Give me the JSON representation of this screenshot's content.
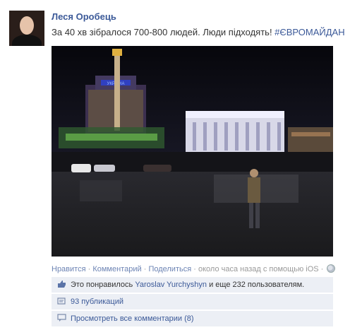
{
  "post": {
    "author": "Леся Оробець",
    "message_text": "За 40 хв зібралося 700-800 людей. Люди підходять! ",
    "hashtag": "#ЄВРОМАЙДАН"
  },
  "photo": {
    "hotel_sign": "УКРАЇНА"
  },
  "actions": {
    "like": "Нравится",
    "comment": "Комментарий",
    "share": "Поделиться",
    "time": "около часа назад с помощью iOS"
  },
  "likes": {
    "prefix": "Это понравилось ",
    "name": "Yaroslav Yurchyshyn",
    "suffix": " и еще 232 пользователям."
  },
  "shares": {
    "label": "93 публикаций"
  },
  "comments": {
    "label": "Просмотреть все комментарии (8)"
  },
  "icons": {
    "like": "thumbs-up-icon",
    "share": "share-icon",
    "comment": "comment-icon",
    "privacy": "globe-icon"
  }
}
